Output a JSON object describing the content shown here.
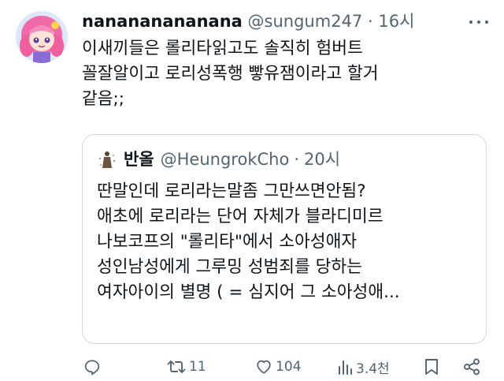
{
  "tweet": {
    "display_name": "nanananananana",
    "handle": "@sungum247",
    "separator": "·",
    "time": "16시",
    "text_lines": [
      "이새끼들은 롤리타읽고도 솔직히 험버트",
      "꼴잘알이고 로리성폭행 빻유잼이라고 할거",
      "같음;;"
    ]
  },
  "quote": {
    "display_name": "반올",
    "handle": "@HeungrokCho",
    "separator": "·",
    "time": "20시",
    "text_lines": [
      "딴말인데 로리라는말좀 그만쓰면안됨?",
      "애초에 로리라는 단어 자체가 블라디미르",
      "나보코프의 \"롤리타\"에서 소아성애자",
      "성인남성에게 그루밍 성범죄를 당하는",
      "여자아이의 별명 ( = 심지어 그 소아성애..."
    ]
  },
  "actions": {
    "reply_icon": "reply-icon",
    "retweet_count": "11",
    "like_count": "104",
    "views_count": "3.4천",
    "bookmark_icon": "bookmark-icon",
    "share_icon": "share-icon"
  },
  "colors": {
    "text": "#0f1419",
    "secondary": "#536471",
    "border": "#cfd9de"
  }
}
